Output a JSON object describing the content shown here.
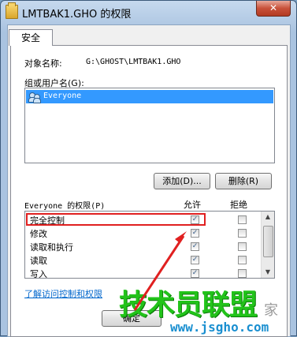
{
  "window": {
    "title": "LMTBAK1.GHO 的权限",
    "close_glyph": "✕"
  },
  "tabs": [
    {
      "label": "安全"
    }
  ],
  "object": {
    "label": "对象名称:",
    "value": "G:\\GHOST\\LMTBAK1.GHO"
  },
  "groups": {
    "label": "组或用户名(G):",
    "items": [
      {
        "name": "Everyone",
        "selected": true
      }
    ]
  },
  "buttons": {
    "add": "添加(D)...",
    "remove": "删除(R)",
    "ok": "确定"
  },
  "permissions": {
    "label": "Everyone 的权限(P)",
    "allow_header": "允许",
    "deny_header": "拒绝",
    "rows": [
      {
        "name": "完全控制",
        "allow": "✓",
        "deny": ""
      },
      {
        "name": "修改",
        "allow": "✓",
        "deny": ""
      },
      {
        "name": "读取和执行",
        "allow": "✓",
        "deny": ""
      },
      {
        "name": "读取",
        "allow": "✓",
        "deny": ""
      },
      {
        "name": "写入",
        "allow": "✓",
        "deny": ""
      }
    ]
  },
  "link": "了解访问控制和权限",
  "watermark": {
    "text": "技术员联盟",
    "url": "www.jsgho.com",
    "extra": "家"
  },
  "colors": {
    "selection": "#3399ff",
    "highlight_box": "#e02020",
    "watermark_green": "#22c31a"
  }
}
